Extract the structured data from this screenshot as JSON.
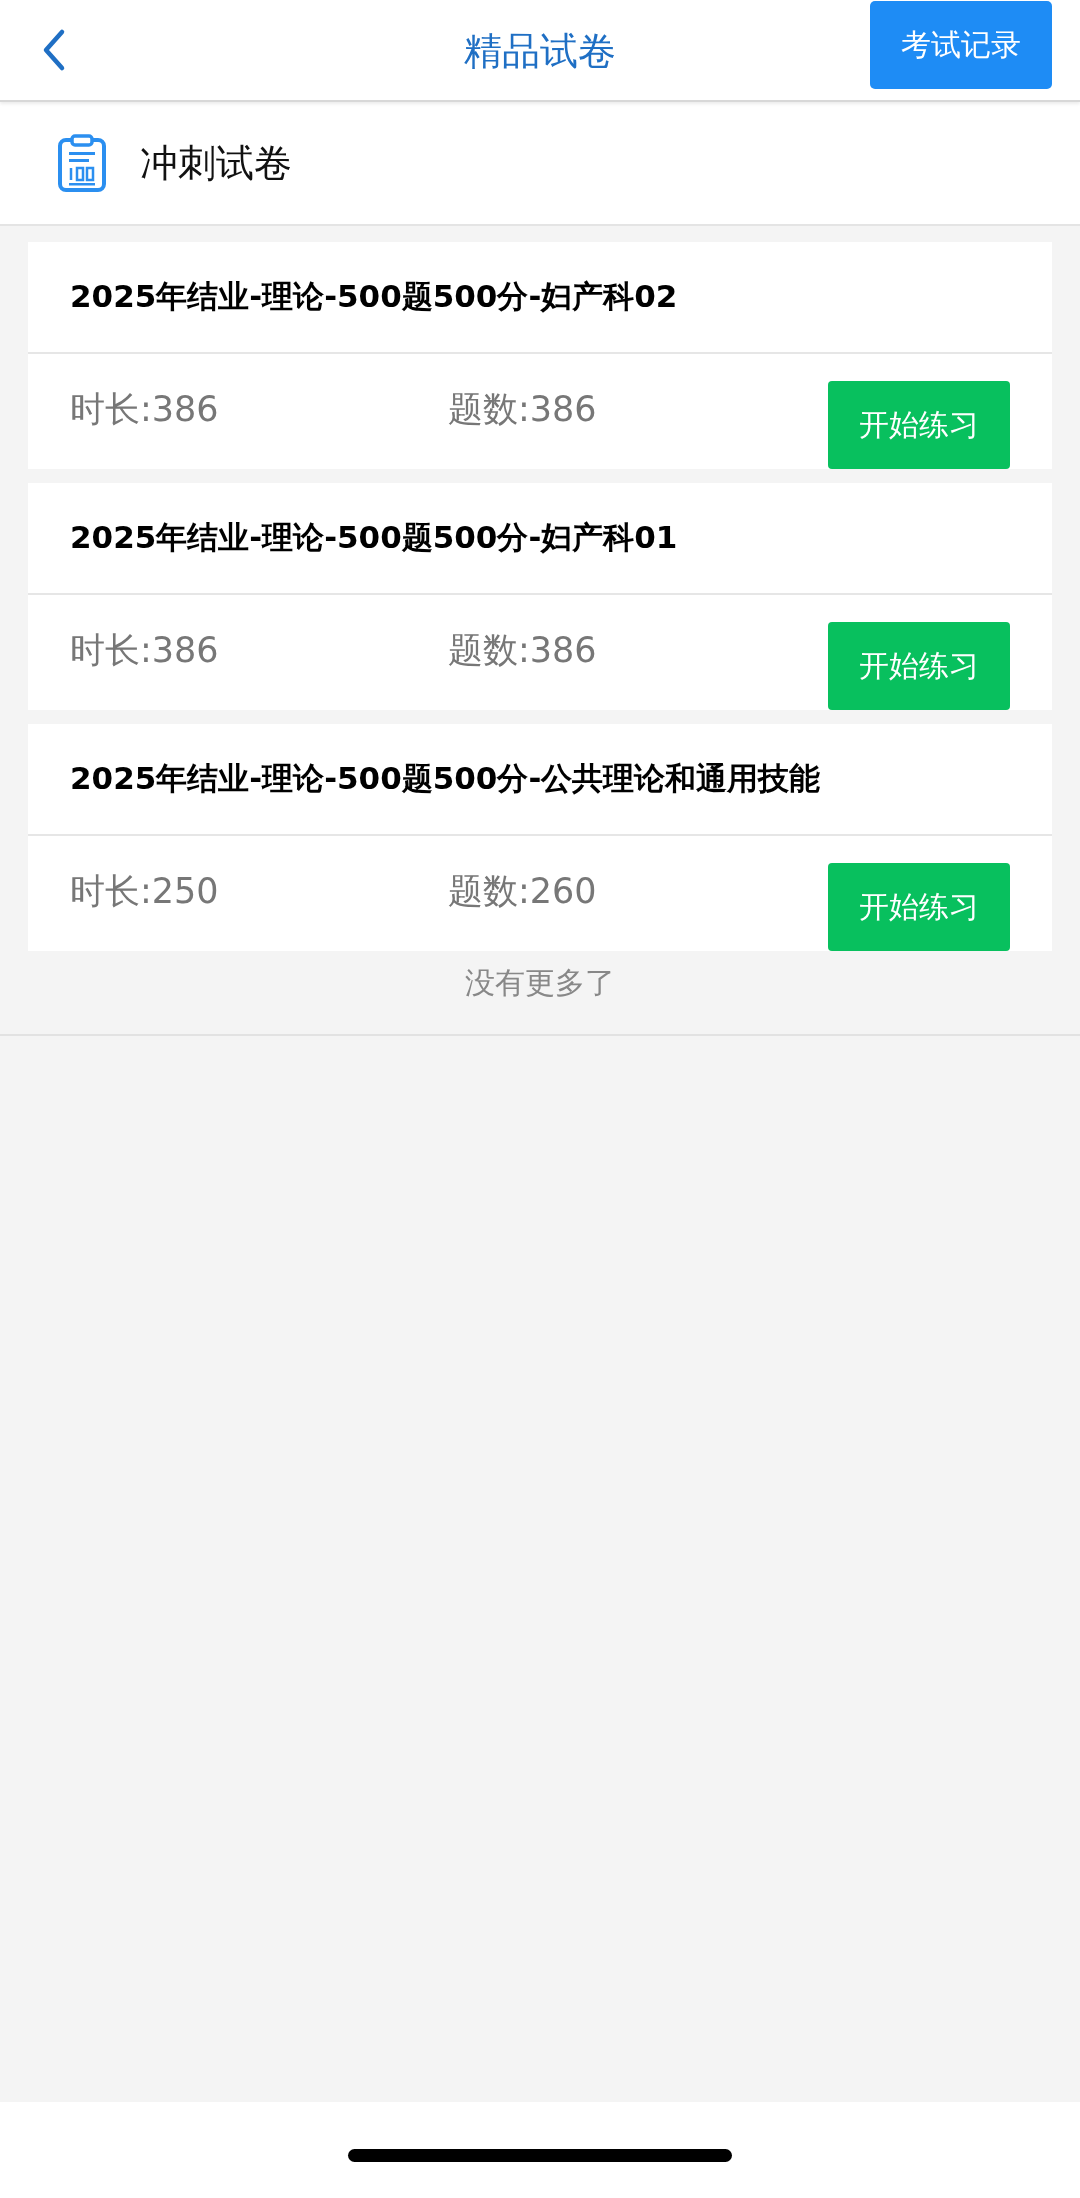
{
  "header": {
    "title": "精品试卷",
    "action": "考试记录"
  },
  "section": {
    "title": "冲刺试卷"
  },
  "papers": [
    {
      "title": "2025年结业-理论-500题500分-妇产科02",
      "duration": "时长:386",
      "questions": "题数:386",
      "button": "开始练习"
    },
    {
      "title": "2025年结业-理论-500题500分-妇产科01",
      "duration": "时长:386",
      "questions": "题数:386",
      "button": "开始练习"
    },
    {
      "title": "2025年结业-理论-500题500分-公共理论和通用技能",
      "duration": "时长:250",
      "questions": "题数:260",
      "button": "开始练习"
    }
  ],
  "footer_note": "没有更多了"
}
